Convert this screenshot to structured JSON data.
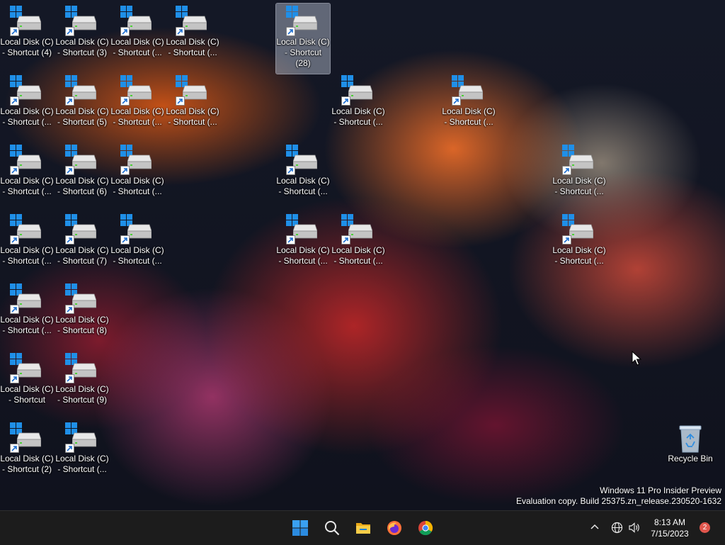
{
  "desktop": {
    "icons": [
      {
        "label": "Local Disk (C)\n- Shortcut (4)"
      },
      {
        "label": "Local Disk (C)\n- Shortcut (3)"
      },
      {
        "label": "Local Disk (C)\n- Shortcut (..."
      },
      {
        "label": "Local Disk (C)\n- Shortcut (..."
      },
      {
        "label": "Local Disk (C)\n- Shortcut\n(28)",
        "selected": true
      },
      {
        "label": "Local Disk (C)\n- Shortcut (..."
      },
      {
        "label": "Local Disk (C)\n- Shortcut (5)"
      },
      {
        "label": "Local Disk (C)\n- Shortcut (..."
      },
      {
        "label": "Local Disk (C)\n- Shortcut (..."
      },
      {
        "label": "Local Disk (C)\n- Shortcut (..."
      },
      {
        "label": "Local Disk (C)\n- Shortcut (..."
      },
      {
        "label": "Local Disk (C)\n- Shortcut (..."
      },
      {
        "label": "Local Disk (C)\n- Shortcut (6)"
      },
      {
        "label": "Local Disk (C)\n- Shortcut (..."
      },
      {
        "label": "Local Disk (C)\n- Shortcut (..."
      },
      {
        "label": "Local Disk (C)\n- Shortcut (..."
      },
      {
        "label": "Local Disk (C)\n- Shortcut (..."
      },
      {
        "label": "Local Disk (C)\n- Shortcut (7)"
      },
      {
        "label": "Local Disk (C)\n- Shortcut (..."
      },
      {
        "label": "Local Disk (C)\n- Shortcut (..."
      },
      {
        "label": "Local Disk (C)\n- Shortcut (..."
      },
      {
        "label": "Local Disk (C)\n- Shortcut (..."
      },
      {
        "label": "Local Disk (C)\n- Shortcut (..."
      },
      {
        "label": "Local Disk (C)\n- Shortcut (8)"
      },
      {
        "label": "Local Disk (C)\n- Shortcut"
      },
      {
        "label": "Local Disk (C)\n- Shortcut (9)"
      },
      {
        "label": "Local Disk (C)\n- Shortcut (2)"
      },
      {
        "label": "Local Disk (C)\n- Shortcut (..."
      }
    ],
    "recycle_bin": {
      "label": "Recycle Bin"
    }
  },
  "watermark": {
    "line1": "Windows 11 Pro Insider Preview",
    "line2": "Evaluation copy. Build 25375.zn_release.230520-1632"
  },
  "taskbar": {
    "apps": [
      {
        "name": "start-button",
        "icon": "windows-logo-icon"
      },
      {
        "name": "search-button",
        "icon": "search-icon"
      },
      {
        "name": "file-explorer-button",
        "icon": "folder-icon"
      },
      {
        "name": "firefox-button",
        "icon": "firefox-icon"
      },
      {
        "name": "chrome-button",
        "icon": "chrome-icon"
      }
    ],
    "tray": {
      "icons": [
        "chevron-up-icon",
        "network-globe-icon",
        "volume-icon"
      ],
      "time": "8:13 AM",
      "date": "7/15/2023",
      "notification_count": "2"
    }
  },
  "colors": {
    "taskbar_bg": "#1c1c1c",
    "accent_blue": "#1f8fe8",
    "notification_badge": "#e0564d"
  }
}
